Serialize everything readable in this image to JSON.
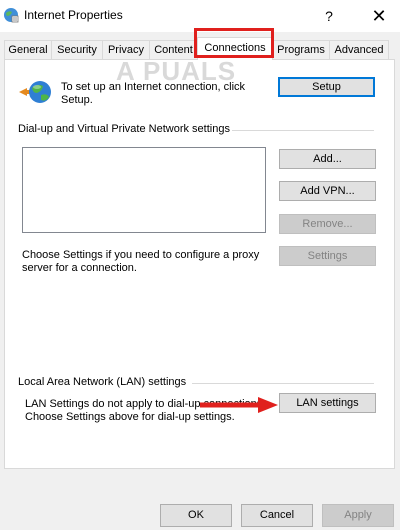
{
  "window": {
    "title": "Internet Properties",
    "help_label": "?",
    "close_label": "✕",
    "icon": "internet-options-icon"
  },
  "tabs": [
    {
      "label": "General",
      "active": false
    },
    {
      "label": "Security",
      "active": false
    },
    {
      "label": "Privacy",
      "active": false
    },
    {
      "label": "Content",
      "active": false
    },
    {
      "label": "Connections",
      "active": true
    },
    {
      "label": "Programs",
      "active": false
    },
    {
      "label": "Advanced",
      "active": false
    }
  ],
  "setup": {
    "text_line1": "To set up an Internet connection, click",
    "text_line2": "Setup.",
    "button_label": "Setup",
    "icon": "globe-network-icon"
  },
  "dialup": {
    "header": "Dial-up and Virtual Private Network settings",
    "add_label": "Add...",
    "add_vpn_label": "Add VPN...",
    "remove_label": "Remove...",
    "settings_label": "Settings",
    "proxy_text_line1": "Choose Settings if you need to configure a proxy",
    "proxy_text_line2": "server for a connection."
  },
  "lan": {
    "header": "Local Area Network (LAN) settings",
    "text_line1": "LAN Settings do not apply to dial-up connections.",
    "text_line2": "Choose Settings above for dial-up settings.",
    "button_label": "LAN settings"
  },
  "watermark": {
    "text": "A PUALS"
  },
  "footer": {
    "ok_label": "OK",
    "cancel_label": "Cancel",
    "apply_label": "Apply"
  },
  "colors": {
    "highlight": "#e0201d",
    "default_button_border": "#0078d7"
  }
}
